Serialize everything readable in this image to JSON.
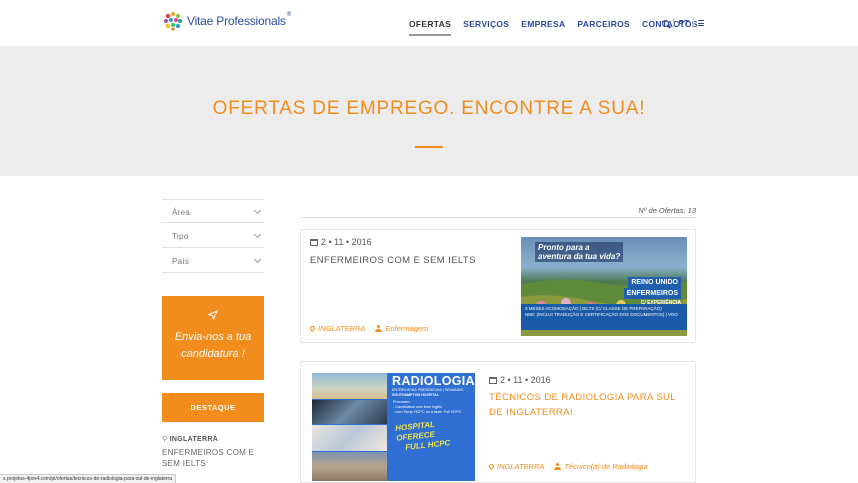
{
  "brand": {
    "name": "Vitae Professionals",
    "mark": "®"
  },
  "nav": {
    "items": [
      "OFERTAS",
      "SERVIÇOS",
      "EMPRESA",
      "PARCEIROS",
      "CONTACTOS"
    ],
    "active": "OFERTAS",
    "language": "PT",
    "icons": [
      "search-icon",
      "menu-icon"
    ]
  },
  "hero": {
    "title": "OFERTAS DE EMPREGO. ENCONTRE A SUA!"
  },
  "sidebar": {
    "filters": [
      "Área",
      "Tipo",
      "País"
    ],
    "send_cta": {
      "line1": "Envia-nos a tua",
      "line2": "candidatura !"
    },
    "featured_label": "DESTAQUE",
    "featured_location": "INGLATERRA",
    "featured_title": "ENFERMEIROS COM E SEM IELTS"
  },
  "results": {
    "count_label": "Nº de Ofertas: 13"
  },
  "offers": [
    {
      "date": "2 • 11 • 2016",
      "title": "ENFERMEIROS COM E SEM IELTS",
      "location": "INGLATERRA",
      "category": "Enfermagem",
      "image": {
        "headline_1": "Pronto para a",
        "headline_2": "aventura da tua vida?",
        "right_1": "REINO UNIDO",
        "right_2": "ENFERMEIROS",
        "right_3": "C/ EXPERIÊNCIA",
        "band_1": "3 MESES ACOMODAÇÃO | IELTS (C/ CLASSE DE PREPARAÇÃO)",
        "band_2": "NMC (INCLUI TRADUÇÃO E CERTIFICAÇÃO DOS DOCUMENTOS) | VOO"
      }
    },
    {
      "date": "2 • 11 • 2016",
      "title": "TÉCNICOS DE RADIOLOGIA PARA SUL DE INGLATERRA!",
      "location": "INGLATERRA",
      "category": "Técnico(a) de Radiologia",
      "image": {
        "title": "RADIOLOGIA",
        "subtitle": "ENTREVISTAS PRESENCIAIS | SEMANAIS",
        "hospital": "SOUTHAMPTON HOSPITAL",
        "list_heading": "Procuram:",
        "list_1": "- Candidatos com bom inglês",
        "list_2": "- com Temp HCPC ou a fazer Full HCPC",
        "offer_1": "HOSPITAL OFERECE",
        "offer_2": "FULL HCPC"
      }
    }
  ],
  "status_url": "s.projetos-4por4.com/pt/ofertas/tecnicos-de-radiologia-para-sul-de-inglaterra",
  "colors": {
    "accent": "#f28c1c",
    "brand_blue": "#2b4a9c",
    "hero_bg": "#ececec"
  }
}
